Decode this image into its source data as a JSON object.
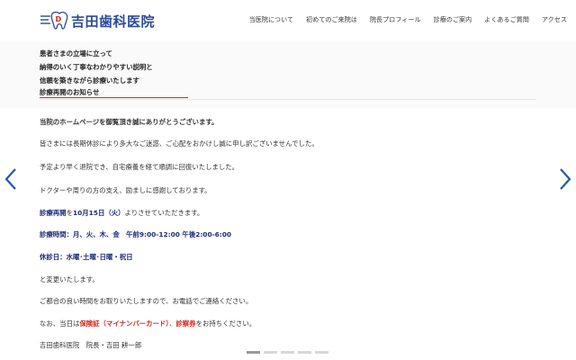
{
  "header": {
    "logo_text": "吉田歯科医院",
    "nav": [
      "当医院について",
      "初めてのご来院は",
      "院長プロフィール",
      "診療のご案内",
      "よくあるご質問",
      "アクセス"
    ]
  },
  "hero": {
    "tagline": [
      "患者さまの立場に立って",
      "納得のいく丁寧なわかりやすい説明と",
      "信頼を築きながら診療いたします"
    ],
    "notice_title": "診療再開のお知らせ"
  },
  "notice": {
    "greeting": "当院のホームページを御覧頂き誠にありがとうございます。",
    "apology": "皆さまには長期休診により多大なご迷惑、ご心配をおかけし誠に申し訳ございませんでした。",
    "recovery": "予定より早く退院でき、自宅療養を経て順調に回復いたしました。",
    "thanks": "ドクターや周りの方の支え、励ましに感謝しております。",
    "reopen_prefix": "診療再開",
    "reopen_mid": "を",
    "reopen_date": "10月15日（火）",
    "reopen_suffix": "よりさせていただきます。",
    "hours_label": "診療時間",
    "hours_value": "：月、火、木、金　午前9:00-12:00 午後2:00-6:00",
    "closed_label": "休診日",
    "closed_value": "：水曜･土曜･日曜・祝日",
    "changed": "と変更いたします。",
    "contact": "ご都合の良い時間をお取りいたしますので、お電話でご連絡ください。",
    "bring_prefix": "なお、当日は",
    "bring_card": "保険証（マイナンバーカード）",
    "bring_sep": "、",
    "bring_ticket": "診察券",
    "bring_suffix": "をお持ちください。",
    "signature": "吉田歯科医院　院長・吉田 耕一郎"
  },
  "slider": {
    "dot_count": 5,
    "active_index": 0
  },
  "colors": {
    "brand": "#2b4a9a",
    "navy": "#1f2a7a",
    "red": "#d6261a",
    "arrow": "#1e5aa8",
    "underline": "#b23b2a"
  },
  "icons": {
    "logo": "tooth-logo-icon",
    "prev": "chevron-left-icon",
    "next": "chevron-right-icon"
  }
}
